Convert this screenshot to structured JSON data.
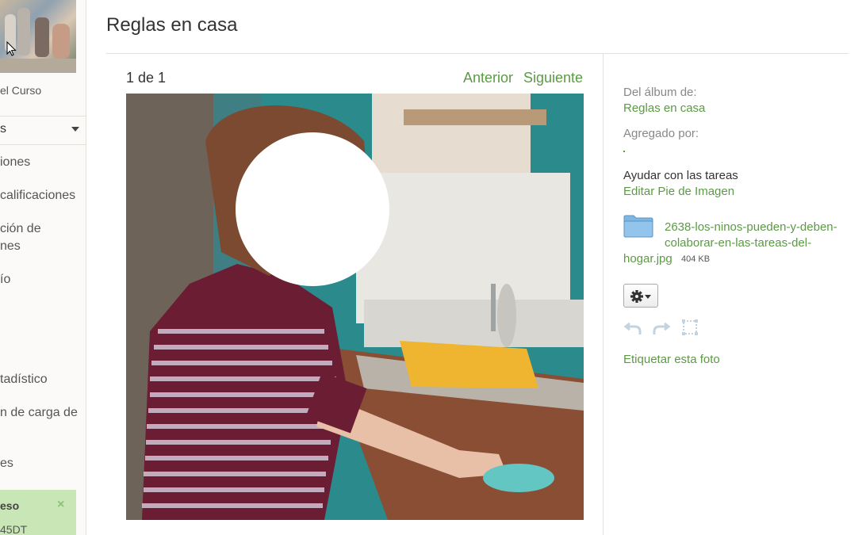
{
  "sidebar": {
    "course_link": "el Curso",
    "section_head": "s",
    "items": [
      {
        "label": "iones"
      },
      {
        "label": "calificaciones"
      },
      {
        "label": "ción de"
      },
      {
        "label": "nes"
      },
      {
        "label": "ío"
      },
      {
        "label": "tadístico"
      },
      {
        "label": "n de carga de"
      },
      {
        "label": "es"
      }
    ],
    "notice": {
      "title": "eso",
      "subtitle": "45DT",
      "close": "×"
    }
  },
  "main": {
    "title": "Reglas en casa",
    "counter": "1 de 1",
    "prev_label": "Anterior",
    "next_label": "Siguiente"
  },
  "info": {
    "album_label": "Del álbum de:",
    "album_name": "Reglas en casa",
    "added_by_label": "Agregado por:",
    "caption": "Ayudar con las tareas",
    "edit_caption": "Editar Pie de Imagen",
    "file_name_part1": "2638-los-ninos-pueden-y-deben-colaborar-en-las-tareas-del-",
    "file_name_part2": "hogar.jpg",
    "file_size": "404 KB",
    "tag_photo": "Etiquetar esta foto"
  },
  "colors": {
    "link": "#5c9a45",
    "notice_bg": "#c9e6b6"
  }
}
